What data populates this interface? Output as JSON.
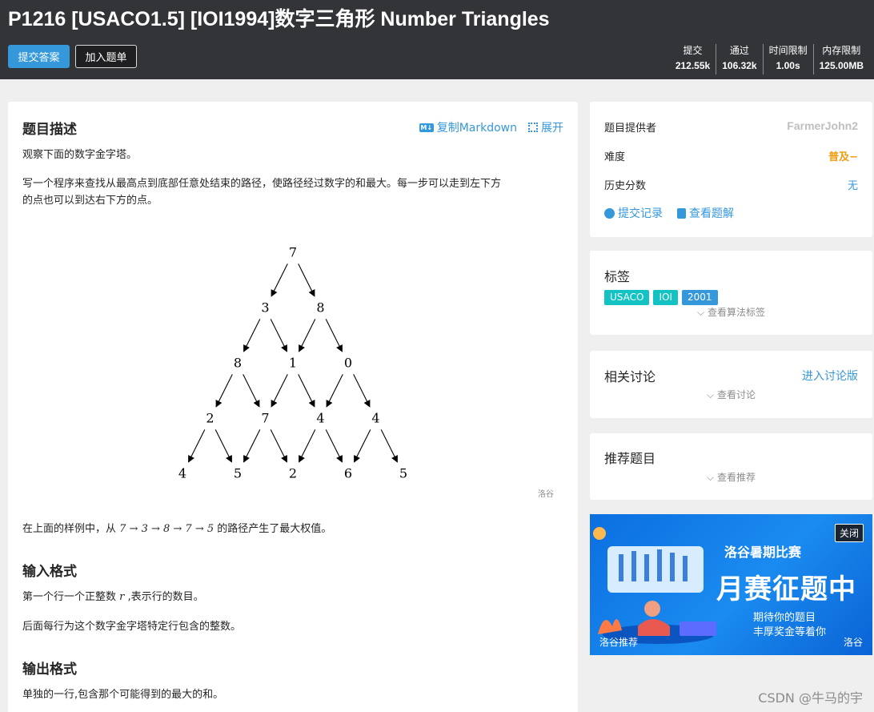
{
  "header": {
    "title": "P1216 [USACO1.5] [IOI1994]数字三角形 Number Triangles",
    "submit_label": "提交答案",
    "add_label": "加入题单",
    "stats": [
      {
        "label": "提交",
        "value": "212.55k"
      },
      {
        "label": "通过",
        "value": "106.32k"
      },
      {
        "label": "时间限制",
        "value": "1.00s"
      },
      {
        "label": "内存限制",
        "value": "125.00MB"
      }
    ]
  },
  "problem": {
    "desc_title": "题目描述",
    "copy_md": "复制Markdown",
    "expand": "展开",
    "p1": "观察下面的数字金字塔。",
    "p2a": "写一个程序来查找从最高点到底部任意处结束的路径，使路径经过数字的和最大。每一步可以走到左下方",
    "p2b": "的点也可以到达右下方的点。",
    "triangle": [
      [
        7
      ],
      [
        3,
        8
      ],
      [
        8,
        1,
        0
      ],
      [
        2,
        7,
        4,
        4
      ],
      [
        4,
        5,
        2,
        6,
        5
      ]
    ],
    "watermark": "洛谷",
    "p3_pre": "在上面的样例中，从 ",
    "p3_path": "7 → 3 → 8 → 7 → 5",
    "p3_post": " 的路径产生了最大权值。",
    "input_title": "输入格式",
    "input_p1_pre": "第一个行一个正整数 ",
    "input_p1_var": "r",
    "input_p1_post": " ,表示行的数目。",
    "input_p2": "后面每行为这个数字金字塔特定行包含的整数。",
    "output_title": "输出格式",
    "output_p1": "单独的一行,包含那个可能得到的最大的和。"
  },
  "info": {
    "provider_label": "题目提供者",
    "provider": "FarmerJohn2",
    "difficulty_label": "难度",
    "difficulty": "普及−",
    "history_label": "历史分数",
    "history": "无",
    "records": "提交记录",
    "solutions": "查看题解"
  },
  "tags_card": {
    "title": "标签",
    "tags": [
      {
        "text": "USACO",
        "color": "#13c2c2"
      },
      {
        "text": "IOI",
        "color": "#13c2c2"
      },
      {
        "text": "2001",
        "color": "#3498db"
      }
    ],
    "more": "查看算法标签"
  },
  "discuss": {
    "title": "相关讨论",
    "enter": "进入讨论版",
    "more": "查看讨论"
  },
  "recommend": {
    "title": "推荐题目",
    "more": "查看推荐"
  },
  "ad": {
    "close": "关闭",
    "h1": "洛谷暑期比赛",
    "h2": "月赛征题中",
    "s1": "期待你的题目",
    "s2": "丰厚奖金等着你",
    "foot": "洛谷推荐",
    "foot2": "洛谷"
  },
  "csdn": "CSDN @牛马的宇"
}
